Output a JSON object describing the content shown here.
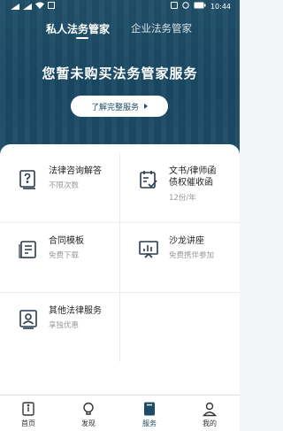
{
  "status_bar": {
    "time": "10:44",
    "battery": "100"
  },
  "tabs": [
    {
      "label": "私人法务管家",
      "active": true
    },
    {
      "label": "企业法务管家",
      "active": false
    }
  ],
  "hero": {
    "headline": "您暂未购买法务管家服务",
    "cta_label": "了解完整服务"
  },
  "services": [
    {
      "title_line1": "法律咨询解答",
      "title_line2": "",
      "subtitle": "不限次数",
      "icon": "question-document-icon"
    },
    {
      "title_line1": "文书/律师函",
      "title_line2": "债权催收函",
      "subtitle": "12份/年",
      "icon": "calendar-check-icon"
    },
    {
      "title_line1": "合同模板",
      "title_line2": "",
      "subtitle": "免费下载",
      "icon": "contract-document-icon"
    },
    {
      "title_line1": "沙龙讲座",
      "title_line2": "",
      "subtitle": "免费携伴参加",
      "icon": "presentation-chart-icon"
    },
    {
      "title_line1": "其他法律服务",
      "title_line2": "",
      "subtitle": "享独优惠",
      "icon": "person-badge-icon"
    }
  ],
  "bottom_nav": [
    {
      "label": "首页",
      "icon": "home-icon",
      "active": false
    },
    {
      "label": "发现",
      "icon": "lightbulb-icon",
      "active": false
    },
    {
      "label": "服务",
      "icon": "bookmark-icon",
      "active": true
    },
    {
      "label": "我的",
      "icon": "user-icon",
      "active": false
    }
  ],
  "colors": {
    "primary": "#1e4c66",
    "muted": "#9a9a9a"
  }
}
